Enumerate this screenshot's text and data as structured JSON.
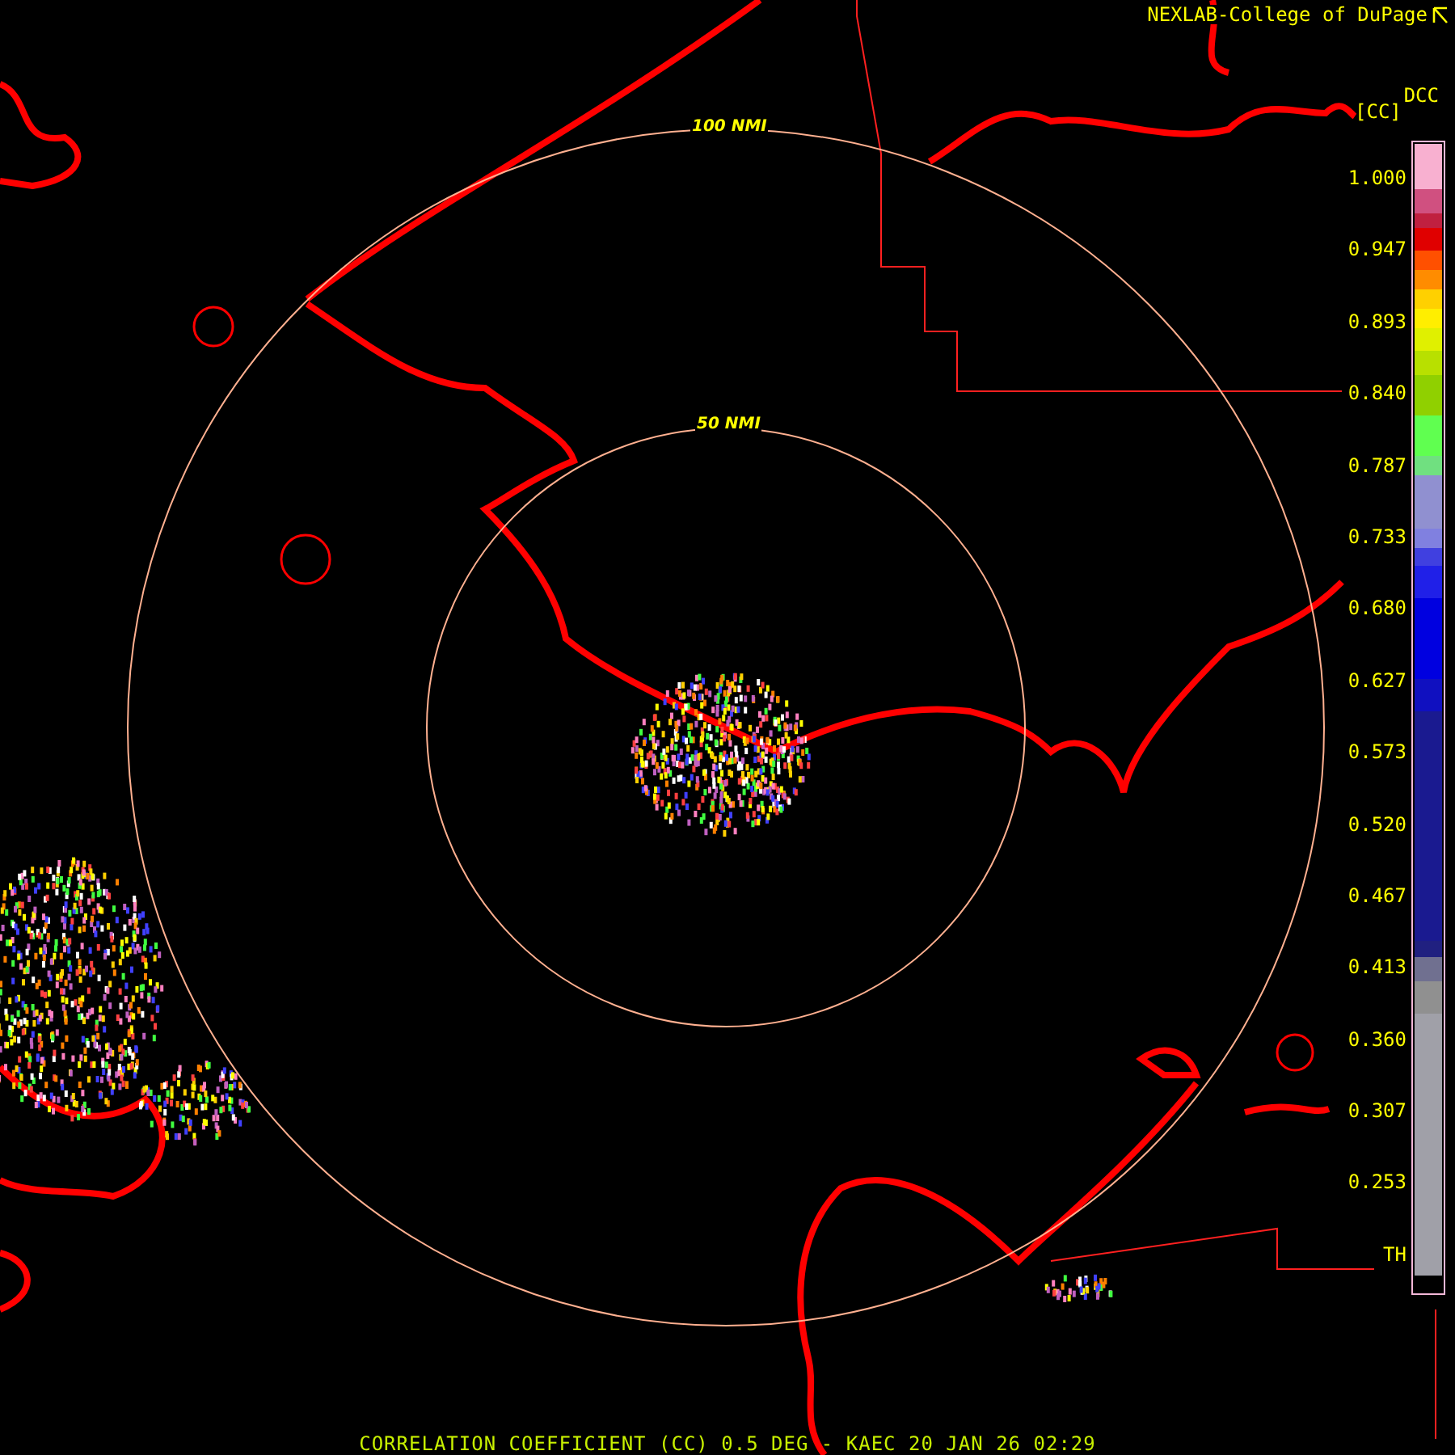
{
  "credit": "NEXLAB-College of DuPage",
  "legend": {
    "product": "DCC",
    "unit": "[CC]",
    "labels": [
      "1.000",
      "0.947",
      "0.893",
      "0.840",
      "0.787",
      "0.733",
      "0.680",
      "0.627",
      "0.573",
      "0.520",
      "0.467",
      "0.413",
      "0.360",
      "0.307",
      "0.253",
      "TH"
    ]
  },
  "range_rings": [
    {
      "label": "100 NMI"
    },
    {
      "label": "50 NMI"
    }
  ],
  "caption": "CORRELATION COEFFICIENT (CC) 0.5 DEG - KAEC 20 JAN 26 02:29"
}
